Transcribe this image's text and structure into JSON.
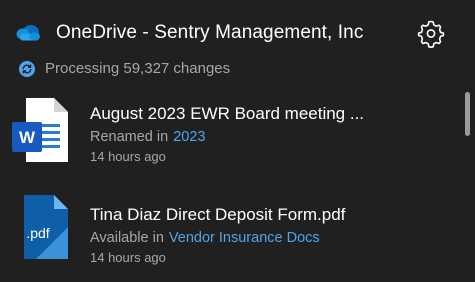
{
  "header": {
    "title": "OneDrive - Sentry Management, Inc",
    "cloud_icon": "onedrive-cloud-icon",
    "settings_icon": "gear-icon"
  },
  "status": {
    "text": "Processing 59,327 changes",
    "icon": "sync-icon"
  },
  "files": [
    {
      "name": "August 2023 EWR Board meeting ...",
      "action": "Renamed in",
      "location": "2023",
      "time": "14 hours ago",
      "icon": "word-document-icon"
    },
    {
      "name": "Tina Diaz Direct Deposit Form.pdf",
      "action": "Available in",
      "location": "Vendor Insurance Docs",
      "time": "14 hours ago",
      "icon": "pdf-file-icon"
    }
  ],
  "colors": {
    "background": "#202020",
    "text": "#ffffff",
    "secondary_text": "#a7a7a7",
    "link": "#4ea5ec",
    "onedrive_blue": "#1a73e8"
  }
}
